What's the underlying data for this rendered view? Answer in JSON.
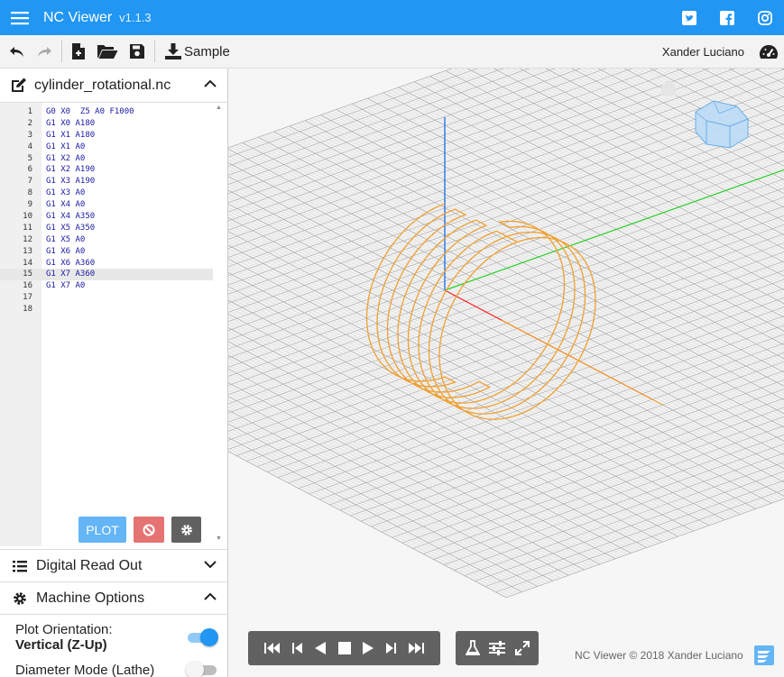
{
  "app": {
    "title": "NC Viewer",
    "version": "v1.1.3"
  },
  "toolbar": {
    "sample_label": "Sample",
    "user_name": "Xander Luciano"
  },
  "file": {
    "name": "cylinder_rotational.nc"
  },
  "editor": {
    "active_line": 15,
    "lines": [
      {
        "n": "1",
        "code": "G0 X0  Z5 A0 F1000"
      },
      {
        "n": "2",
        "code": "G1 X0 A180"
      },
      {
        "n": "3",
        "code": "G1 X1 A180"
      },
      {
        "n": "4",
        "code": "G1 X1 A0"
      },
      {
        "n": "5",
        "code": "G1 X2 A0"
      },
      {
        "n": "6",
        "code": "G1 X2 A190"
      },
      {
        "n": "7",
        "code": "G1 X3 A190"
      },
      {
        "n": "8",
        "code": "G1 X3 A0"
      },
      {
        "n": "9",
        "code": "G1 X4 A0"
      },
      {
        "n": "10",
        "code": "G1 X4 A350"
      },
      {
        "n": "11",
        "code": "G1 X5 A350"
      },
      {
        "n": "12",
        "code": "G1 X5 A0"
      },
      {
        "n": "13",
        "code": "G1 X6 A0"
      },
      {
        "n": "14",
        "code": "G1 X6 A360"
      },
      {
        "n": "15",
        "code": "G1 X7 A360"
      },
      {
        "n": "16",
        "code": "G1 X7 A0"
      },
      {
        "n": "17",
        "code": ""
      },
      {
        "n": "18",
        "code": ""
      }
    ]
  },
  "buttons": {
    "plot_label": "PLOT"
  },
  "sections": {
    "dro_label": "Digital Read Out",
    "machine_options_label": "Machine Options"
  },
  "options": {
    "plot_orientation_label": "Plot Orientation:",
    "plot_orientation_value": "Vertical (Z-Up)",
    "plot_orientation_on": true,
    "diameter_mode_label": "Diameter Mode (Lathe)",
    "diameter_mode_on": false
  },
  "footer": {
    "credits": "NC Viewer © 2018 Xander Luciano"
  },
  "colors": {
    "primary": "#2196f3",
    "toolpath": "#f0a030",
    "axis_x": "#ff2020",
    "axis_y": "#22cc22",
    "axis_z": "#2277ee",
    "plot_button": "#64b5f6",
    "clear_button": "#e57373"
  },
  "icons": [
    "menu-icon",
    "twitter-icon",
    "facebook-icon",
    "instagram-icon",
    "undo-icon",
    "redo-icon",
    "new-file-icon",
    "open-folder-icon",
    "save-icon",
    "download-icon",
    "speedometer-icon",
    "edit-icon",
    "chevron-up-icon",
    "list-icon",
    "gear-icon",
    "ban-icon",
    "skip-start-icon",
    "step-back-icon",
    "play-back-icon",
    "stop-icon",
    "play-icon",
    "step-forward-icon",
    "skip-end-icon",
    "flask-icon",
    "sliders-icon",
    "expand-icon",
    "nc-logo-icon",
    "home-icon",
    "view-cube-icon"
  ]
}
